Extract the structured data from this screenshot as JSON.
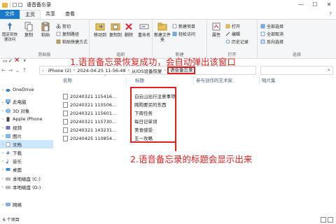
{
  "window": {
    "title": "语音备忘录",
    "minimize": "—",
    "maximize": "☐",
    "close": "✕"
  },
  "tabs": {
    "file": "文件",
    "home": "主页",
    "share": "共享",
    "view": "查看",
    "help": "?"
  },
  "ribbon": {
    "pin_label": "固定到快速访问",
    "copy_label": "复制",
    "paste_label": "粘贴",
    "cut_label": "剪切",
    "copy_path_label": "复制路径",
    "paste_shortcut_label": "粘贴快捷方式",
    "clipboard_group": "剪贴板",
    "move_to_label": "移动到",
    "copy_to_label": "复制到",
    "delete_label": "删除",
    "rename_label": "重命名",
    "organize_group": "组织",
    "new_folder_label": "新建文件夹",
    "new_item_label": "新建项目",
    "easy_access_label": "轻松访问",
    "new_group": "新建",
    "properties_label": "属性",
    "open_label": "打开",
    "edit_label": "编辑",
    "history_label": "历史记录",
    "open_group": "打开",
    "select_all_label": "全部选择",
    "select_none_label": "全部取消",
    "invert_selection_label": "反向选择",
    "select_group": "选择"
  },
  "address": {
    "crumbs": [
      "iPhone (2)",
      "2024-04-25 11-56-48",
      "从iOS设备恢复",
      "语音备忘录"
    ],
    "qa_text": "∨"
  },
  "navpane": {
    "items": [
      {
        "label": "OneDrive"
      },
      {
        "label": "此电脑"
      },
      {
        "label": "3D 对象"
      },
      {
        "label": "Apple iPhone"
      },
      {
        "label": "视频"
      },
      {
        "label": "图片"
      },
      {
        "label": "文档"
      },
      {
        "label": "下载"
      },
      {
        "label": "音乐"
      },
      {
        "label": "桌面"
      },
      {
        "label": "本地磁盘 (C:)"
      },
      {
        "label": "本地磁盘 (D:)"
      },
      {
        "label": "网络"
      }
    ]
  },
  "columns": {
    "name": "名称",
    "title": "标题",
    "artist": "参与创作的艺术家",
    "album": "唱片集"
  },
  "files": [
    {
      "name": "20240321 115416...",
      "title": "白云山出行注意事项"
    },
    {
      "name": "20240321 115506...",
      "title": "网购要买的东西"
    },
    {
      "name": "20240321 115601...",
      "title": "下周任务"
    },
    {
      "name": "20240321 115730...",
      "title": "每日记单词"
    },
    {
      "name": "20240321 143231...",
      "title": "美食感受"
    },
    {
      "name": "20240425 110854...",
      "title": "五一攻略"
    }
  ],
  "annotations": {
    "note1": "1.语音备忘录恢复成功，会自动弹出该窗口",
    "note2": "2.语音备忘录的标题会显示出来"
  },
  "status": {
    "text": "6 个项目"
  },
  "colors": {
    "accent": "#1979ca",
    "annotation_red": "#e01f1f"
  }
}
